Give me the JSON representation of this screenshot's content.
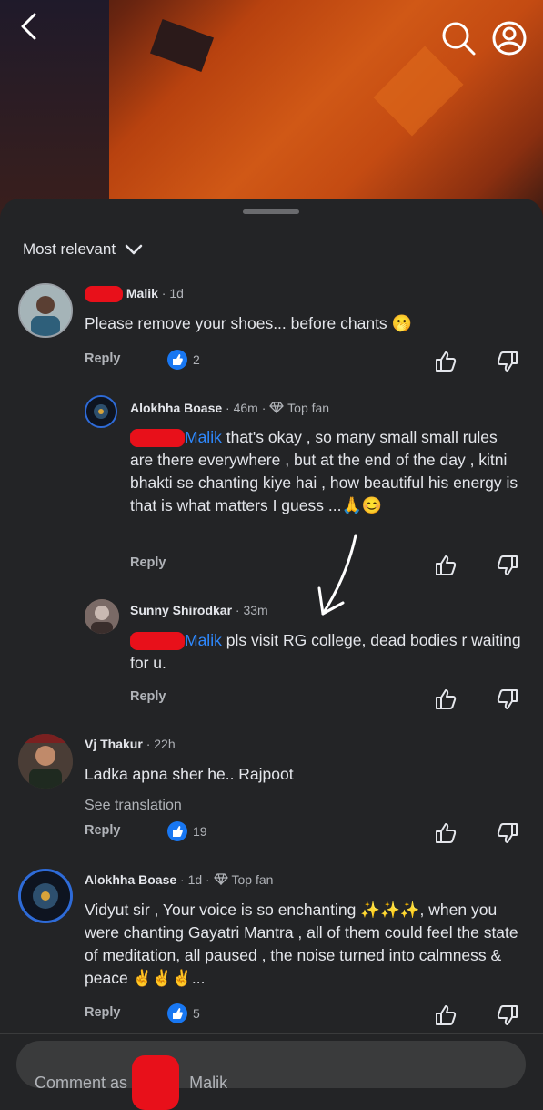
{
  "sort": {
    "label": "Most relevant"
  },
  "comments": [
    {
      "author": "Malik",
      "time": "1d",
      "text": "Please remove your shoes... before chants",
      "emoji": "🫢",
      "reply": "Reply",
      "likes": "2"
    },
    {
      "author": "Alokhha Boase",
      "time": "46m",
      "badge": "Top fan",
      "mention": "Malik",
      "text": "that's okay , so many small small rules are there everywhere , but at the end of the day , kitni bhakti se chanting kiye hai , how beautiful his energy is that is what matters I guess ...",
      "emoji": "🙏😊",
      "reply": "Reply"
    },
    {
      "author": "Sunny Shirodkar",
      "time": "33m",
      "mention": "Malik",
      "text": "pls visit RG  college,  dead bodies r waiting for u.",
      "reply": "Reply"
    },
    {
      "author": "Vj Thakur",
      "time": "22h",
      "text": "Ladka apna sher he.. Rajpoot",
      "see_translation": "See translation",
      "reply": "Reply",
      "likes": "19"
    },
    {
      "author": "Alokhha Boase",
      "time": "1d",
      "badge": "Top fan",
      "text": "Vidyut sir , Your voice is so enchanting ✨✨✨, when you were chanting Gayatri Mantra ,  all of them could feel the state of meditation, all paused , the noise turned into calmness & peace ✌️✌️✌️...",
      "reply": "Reply",
      "likes": "5"
    }
  ],
  "composer": {
    "prefix": "Comment as",
    "name": "Malik"
  },
  "colors": {
    "accent": "#2e89ff",
    "like": "#1877f2",
    "redaction": "#e8101a",
    "sheet": "#232426"
  },
  "icons": [
    "back-icon",
    "search-icon",
    "profile-icon",
    "chevron-down-icon",
    "thumbs-up-icon",
    "thumbs-down-icon",
    "diamond-icon",
    "like-reaction-icon"
  ]
}
